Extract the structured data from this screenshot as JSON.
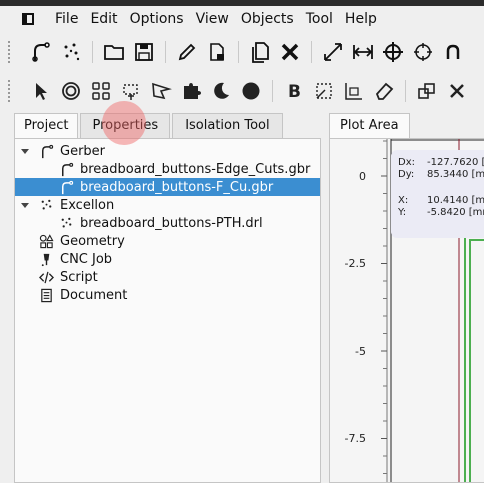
{
  "menu": [
    "File",
    "Edit",
    "Options",
    "View",
    "Objects",
    "Tool",
    "Help"
  ],
  "toolbar1_icons": [
    "gerber-open-icon",
    "excellon-open-icon",
    "folder-open-icon",
    "save-icon",
    "pencil-icon",
    "file-delete-icon",
    "copy-icon",
    "delete-x-icon",
    "zoom-fit-icon",
    "distance-icon",
    "crosshair-icon",
    "target-icon",
    "more-icon"
  ],
  "toolbar2_icons": [
    "pointer-icon",
    "circle-target-icon",
    "grid-icon",
    "select-icon",
    "polygon-icon",
    "puzzle-icon",
    "moon-icon",
    "filled-circle-icon",
    "bold-text-icon",
    "transform-icon",
    "dimension-icon",
    "eraser-icon",
    "group-icon",
    "close-x-icon"
  ],
  "left_tabs": [
    "Project",
    "Properties",
    "Isolation Tool"
  ],
  "tree": {
    "gerber": "Gerber",
    "gerber_file1": "breadboard_buttons-Edge_Cuts.gbr",
    "gerber_file2": "breadboard_buttons-F_Cu.gbr",
    "excellon": "Excellon",
    "excellon_file1": "breadboard_buttons-PTH.drl",
    "geometry": "Geometry",
    "cnc": "CNC Job",
    "script": "Script",
    "document": "Document"
  },
  "plot": {
    "tab": "Plot Area",
    "y_ticks": [
      "0",
      "-2.5",
      "-5",
      "-7.5"
    ],
    "readout": {
      "dx_label": "Dx:",
      "dx_value": "-127.7620 [",
      "dy_label": "Dy:",
      "dy_value": "85.3440 [m",
      "x_label": "X:",
      "x_value": "10.4140 [mr",
      "y_label": "Y:",
      "y_value": "-5.8420 [mr"
    }
  },
  "colors": {
    "selection": "#3b8ed1",
    "trace": "#4caf50",
    "axis": "#8b1a2b"
  }
}
